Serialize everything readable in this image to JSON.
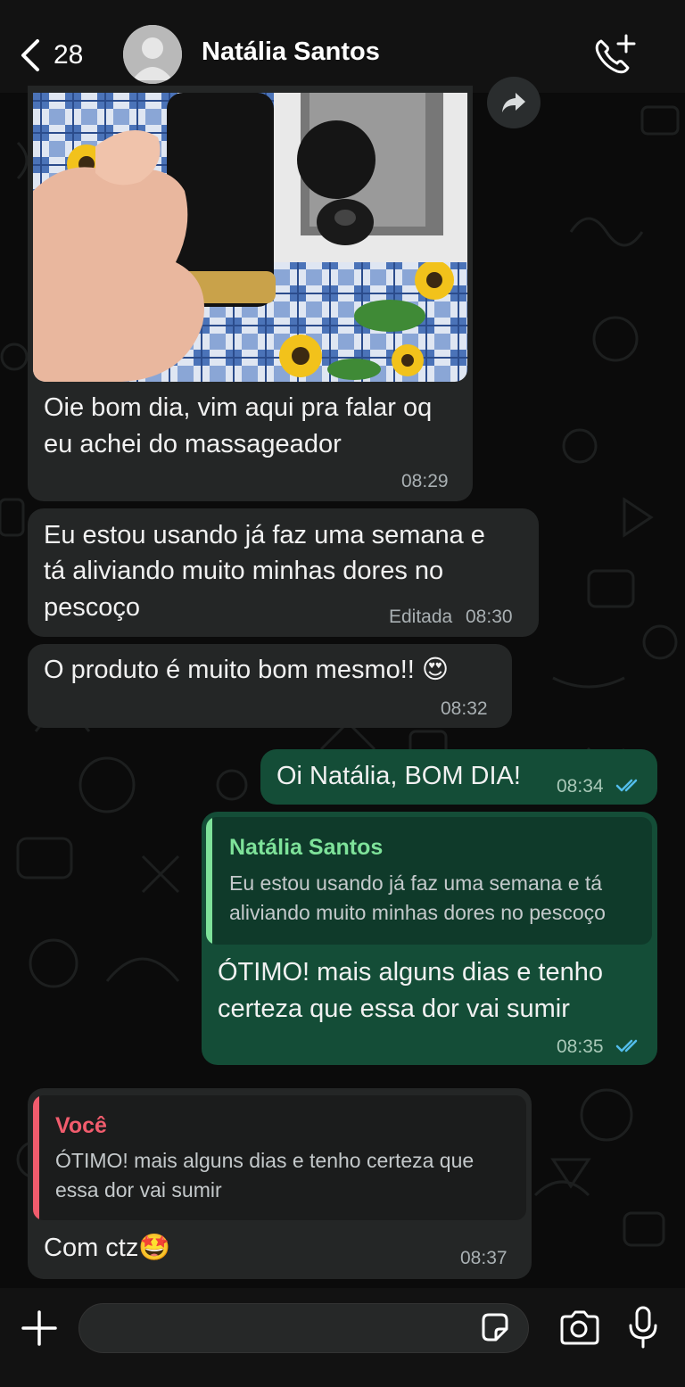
{
  "header": {
    "back_count": "28",
    "contact_name": "Natália Santos"
  },
  "messages": [
    {
      "id": "m1",
      "direction": "incoming",
      "type": "image",
      "text": "Oie bom dia, vim aqui pra falar oq eu achei do massageador",
      "time": "08:29"
    },
    {
      "id": "m2",
      "direction": "incoming",
      "text_line1": "Eu estou usando já faz uma semana e",
      "text_line2": "tá aliviando muito minhas dores no",
      "text_line3": "pescoço",
      "edited_label": "Editada",
      "time": "08:30"
    },
    {
      "id": "m3",
      "direction": "incoming",
      "text": "O produto é muito bom mesmo!! 😍",
      "time": "08:32"
    },
    {
      "id": "m4",
      "direction": "outgoing",
      "text": "Oi Natália, BOM DIA!",
      "time": "08:34",
      "status": "read"
    },
    {
      "id": "m5",
      "direction": "outgoing",
      "quote_author": "Natália Santos",
      "quote_line1": "Eu estou usando já faz uma semana e tá",
      "quote_line2": "aliviando muito minhas dores no pescoço",
      "text_line1": "ÓTIMO! mais alguns dias e tenho",
      "text_line2": "certeza que essa dor vai sumir",
      "time": "08:35",
      "status": "read"
    },
    {
      "id": "m6",
      "direction": "incoming",
      "quote_author": "Você",
      "quote_line1": "ÓTIMO! mais alguns dias e tenho certeza que",
      "quote_line2": "essa dor vai sumir",
      "text": "Com ctz🤩",
      "time": "08:37"
    }
  ],
  "composer": {
    "value": "",
    "placeholder": ""
  },
  "colors": {
    "incoming_bubble": "#242626",
    "outgoing_bubble": "#144d37",
    "read_ticks": "#53bdeb",
    "quote_green": "#7ee29a",
    "quote_red": "#f15c6d"
  },
  "icons": [
    "back-chevron-icon",
    "avatar-placeholder-icon",
    "add-call-icon",
    "forward-icon",
    "read-ticks-icon",
    "plus-icon",
    "sticker-icon",
    "camera-icon",
    "microphone-icon"
  ]
}
